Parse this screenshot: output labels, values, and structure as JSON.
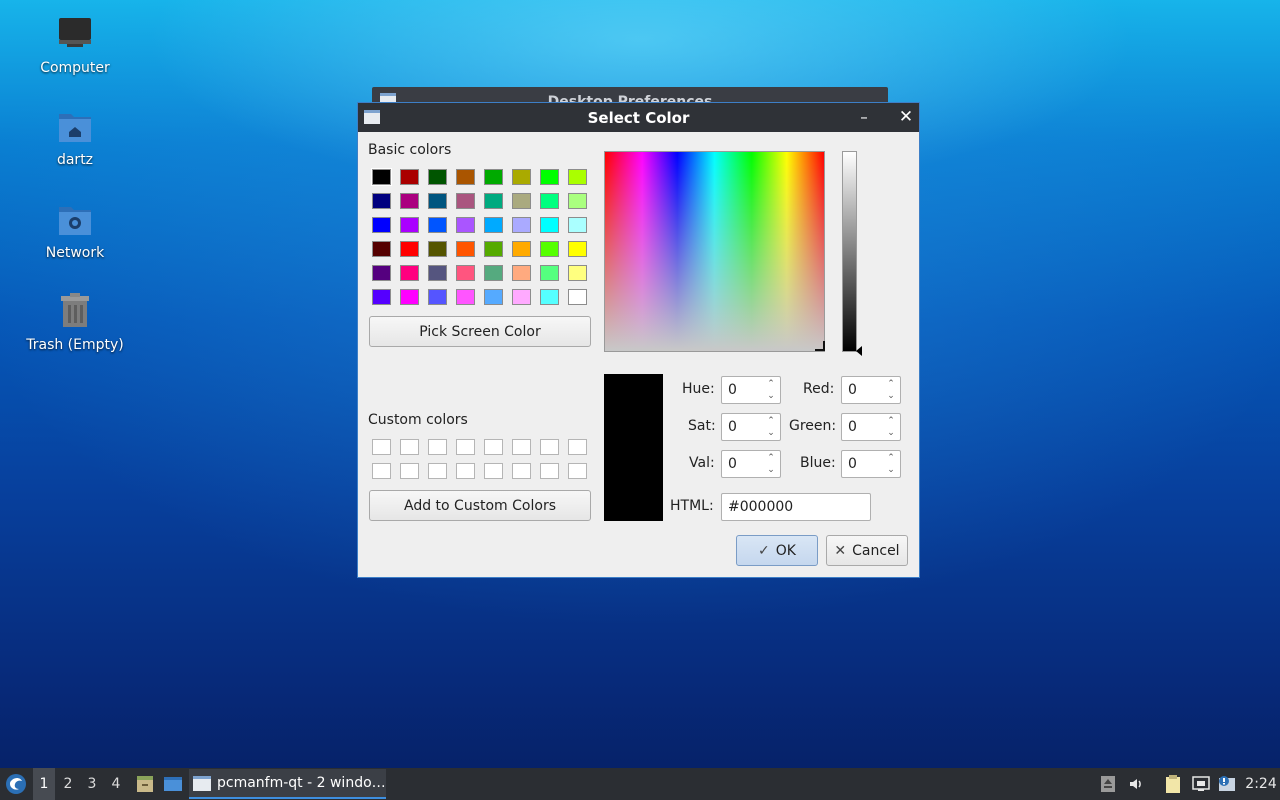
{
  "desktop": {
    "icons": [
      {
        "label": "Computer"
      },
      {
        "label": "dartz"
      },
      {
        "label": "Network"
      },
      {
        "label": "Trash (Empty)"
      }
    ]
  },
  "background_window": {
    "title": "Desktop Preferences"
  },
  "dialog": {
    "title": "Select Color",
    "minimize_icon": "minimize-icon",
    "close_icon": "close-icon",
    "basic_colors_label": "Basic colors",
    "basic_colors": [
      [
        "#000000",
        "#aa0000",
        "#005500",
        "#aa5500",
        "#00aa00",
        "#aaaa00",
        "#00ff00",
        "#aaff00"
      ],
      [
        "#00007f",
        "#aa007f",
        "#00557f",
        "#aa557f",
        "#00aa7f",
        "#aaaa7f",
        "#00ff7f",
        "#aaff7f"
      ],
      [
        "#0000ff",
        "#aa00ff",
        "#0055ff",
        "#aa55ff",
        "#00aaff",
        "#aaaaff",
        "#00ffff",
        "#aaffff"
      ],
      [
        "#550000",
        "#ff0000",
        "#555500",
        "#ff5500",
        "#55aa00",
        "#ffaa00",
        "#55ff00",
        "#ffff00"
      ],
      [
        "#55007f",
        "#ff007f",
        "#55557f",
        "#ff557f",
        "#55aa7f",
        "#ffaa7f",
        "#55ff7f",
        "#ffff7f"
      ],
      [
        "#5500ff",
        "#ff00ff",
        "#5555ff",
        "#ff55ff",
        "#55aaff",
        "#ffaaff",
        "#55ffff",
        "#ffffff"
      ]
    ],
    "pick_screen_color_label": "Pick Screen Color",
    "custom_colors_label": "Custom colors",
    "add_custom_label": "Add to Custom Colors",
    "fields": {
      "hue": {
        "label": "Hue:",
        "value": "0"
      },
      "sat": {
        "label": "Sat:",
        "value": "0"
      },
      "val": {
        "label": "Val:",
        "value": "0"
      },
      "red": {
        "label": "Red:",
        "value": "0"
      },
      "green": {
        "label": "Green:",
        "value": "0"
      },
      "blue": {
        "label": "Blue:",
        "value": "0"
      }
    },
    "html": {
      "label": "HTML:",
      "value": "#000000"
    },
    "current_color": "#000000",
    "ok_label": "OK",
    "cancel_label": "Cancel",
    "ok_icon": "check-icon",
    "cancel_icon": "x-icon"
  },
  "taskbar": {
    "workspaces": [
      "1",
      "2",
      "3",
      "4"
    ],
    "active_workspace": "1",
    "task_label": "pcmanfm-qt - 2 windo…",
    "clock": "2:24"
  }
}
